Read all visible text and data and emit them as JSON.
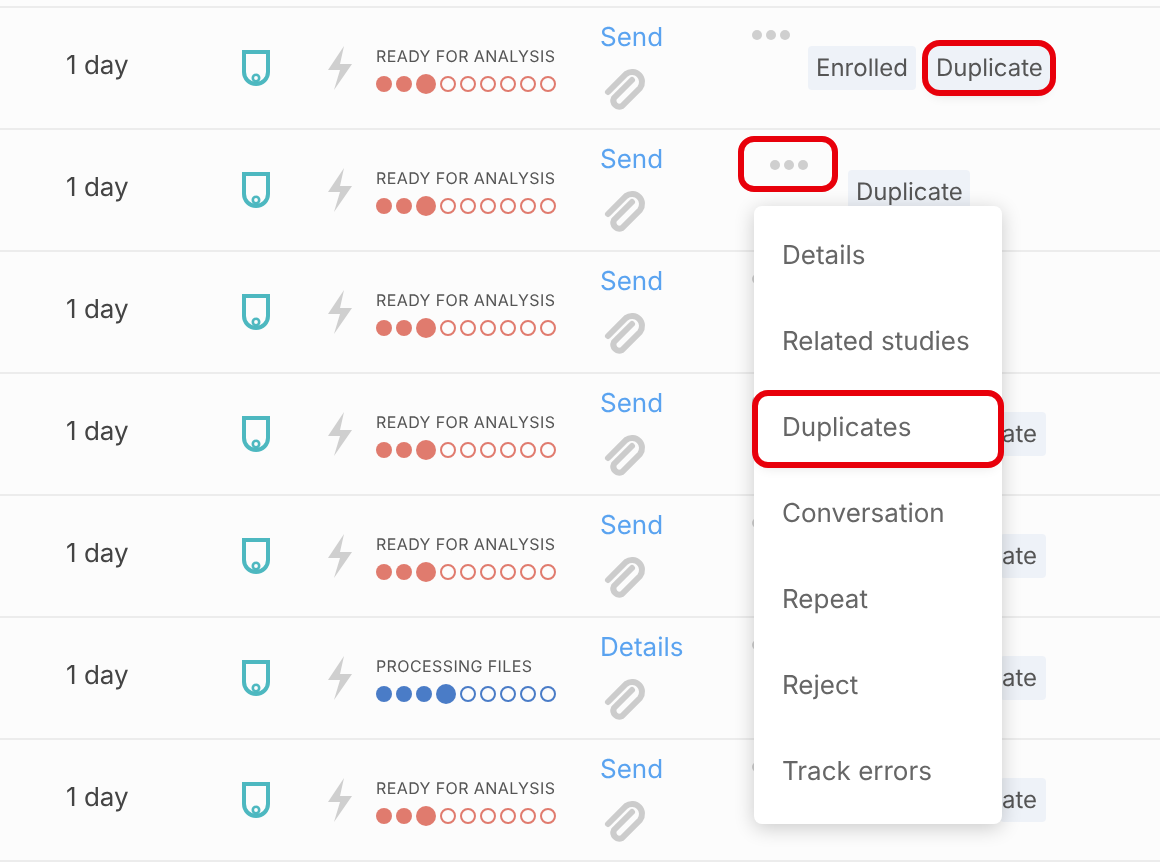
{
  "rows": [
    {
      "age": "1 day",
      "status": {
        "label": "READY FOR ANALYSIS",
        "level": 0.333,
        "color": "#e07b6e"
      },
      "action": "Send",
      "menu_button_highlighted": false,
      "tags": [
        {
          "label": "Enrolled",
          "highlighted": false,
          "partial": false
        },
        {
          "label": "Duplicate",
          "highlighted": true,
          "partial": false
        }
      ]
    },
    {
      "age": "1 day",
      "status": {
        "label": "READY FOR ANALYSIS",
        "level": 0.333,
        "color": "#e07b6e"
      },
      "action": "Send",
      "menu_button_highlighted": true,
      "tags": [
        {
          "label": "Duplicate",
          "highlighted": false,
          "partial": false
        }
      ]
    },
    {
      "age": "1 day",
      "status": {
        "label": "READY FOR ANALYSIS",
        "level": 0.333,
        "color": "#e07b6e"
      },
      "action": "Send",
      "menu_button_highlighted": false,
      "tags": []
    },
    {
      "age": "1 day",
      "status": {
        "label": "READY FOR ANALYSIS",
        "level": 0.333,
        "color": "#e07b6e"
      },
      "action": "Send",
      "menu_button_highlighted": false,
      "tags": [
        {
          "label": "ate",
          "highlighted": false,
          "partial": true
        }
      ]
    },
    {
      "age": "1 day",
      "status": {
        "label": "READY FOR ANALYSIS",
        "level": 0.333,
        "color": "#e07b6e"
      },
      "action": "Send",
      "menu_button_highlighted": false,
      "tags": [
        {
          "label": "ate",
          "highlighted": false,
          "partial": true
        }
      ]
    },
    {
      "age": "1 day",
      "status": {
        "label": "PROCESSING FILES",
        "level": 0.444,
        "color": "#4a7cc7"
      },
      "action": "Details",
      "menu_button_highlighted": false,
      "tags": [
        {
          "label": "ate",
          "highlighted": false,
          "partial": true
        }
      ]
    },
    {
      "age": "1 day",
      "status": {
        "label": "READY FOR ANALYSIS",
        "level": 0.333,
        "color": "#e07b6e"
      },
      "action": "Send",
      "menu_button_highlighted": false,
      "tags": [
        {
          "label": "ate",
          "highlighted": false,
          "partial": true
        }
      ]
    }
  ],
  "menu": [
    {
      "label": "Details",
      "highlighted": false
    },
    {
      "label": "Related studies",
      "highlighted": false
    },
    {
      "label": "Duplicates",
      "highlighted": true
    },
    {
      "label": "Conversation",
      "highlighted": false
    },
    {
      "label": "Repeat",
      "highlighted": false
    },
    {
      "label": "Reject",
      "highlighted": false
    },
    {
      "label": "Track errors",
      "highlighted": false
    }
  ]
}
